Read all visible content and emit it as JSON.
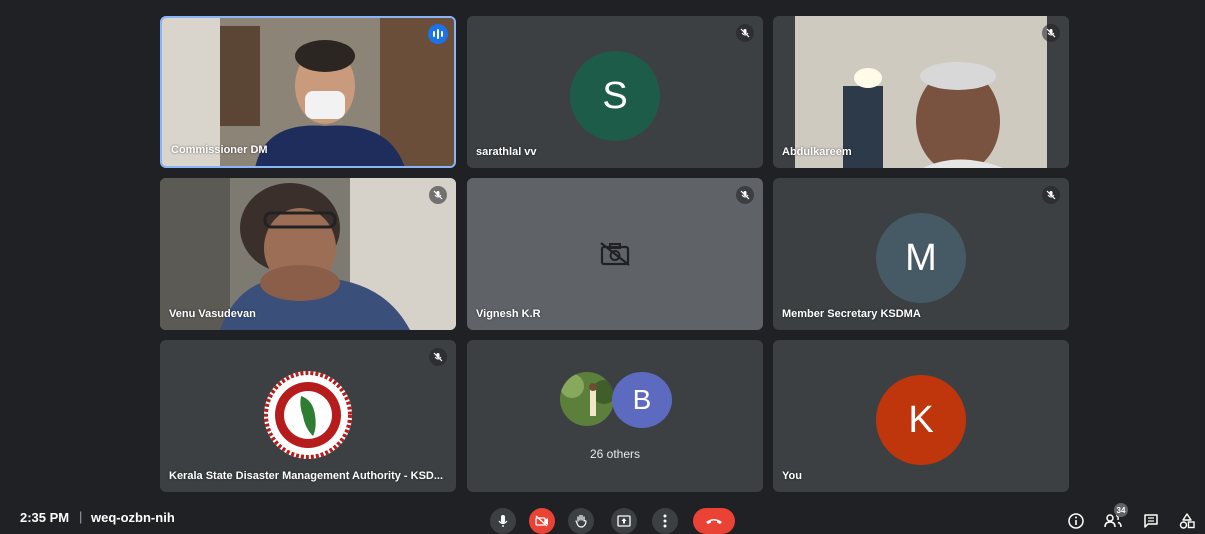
{
  "tiles": [
    {
      "name": "Commissioner DM",
      "type": "video",
      "speaking": true
    },
    {
      "name": "sarathlal vv",
      "type": "avatar",
      "initial": "S",
      "avatar_color": "#1e5c4a",
      "muted": true
    },
    {
      "name": "Abdulkareem",
      "type": "video",
      "muted": true
    },
    {
      "name": "Venu Vasudevan",
      "type": "video",
      "muted": true
    },
    {
      "name": "Vignesh K.R",
      "type": "camera-off",
      "muted": true
    },
    {
      "name": "Member Secretary KSDMA",
      "type": "avatar",
      "initial": "M",
      "avatar_color": "#455a64",
      "muted": true
    },
    {
      "name": "Kerala State Disaster Management Authority - KSD...",
      "type": "logo",
      "muted": true
    },
    {
      "name": "26 others",
      "type": "group",
      "initial": "B",
      "avatar_color": "#5c6bc0"
    },
    {
      "name": "You",
      "type": "avatar",
      "initial": "K",
      "avatar_color": "#bf360c"
    }
  ],
  "bottom_bar": {
    "time": "2:35 PM",
    "separator": "|",
    "meeting_code": "weq-ozbn-nih",
    "participant_count": "34"
  },
  "icons": {
    "mic": "microphone-icon",
    "camera": "camera-off-icon",
    "hand": "raise-hand-icon",
    "present": "present-screen-icon",
    "more": "more-options-icon",
    "end": "end-call-icon",
    "info": "info-icon",
    "people": "people-icon",
    "chat": "chat-icon",
    "activities": "activities-icon"
  }
}
